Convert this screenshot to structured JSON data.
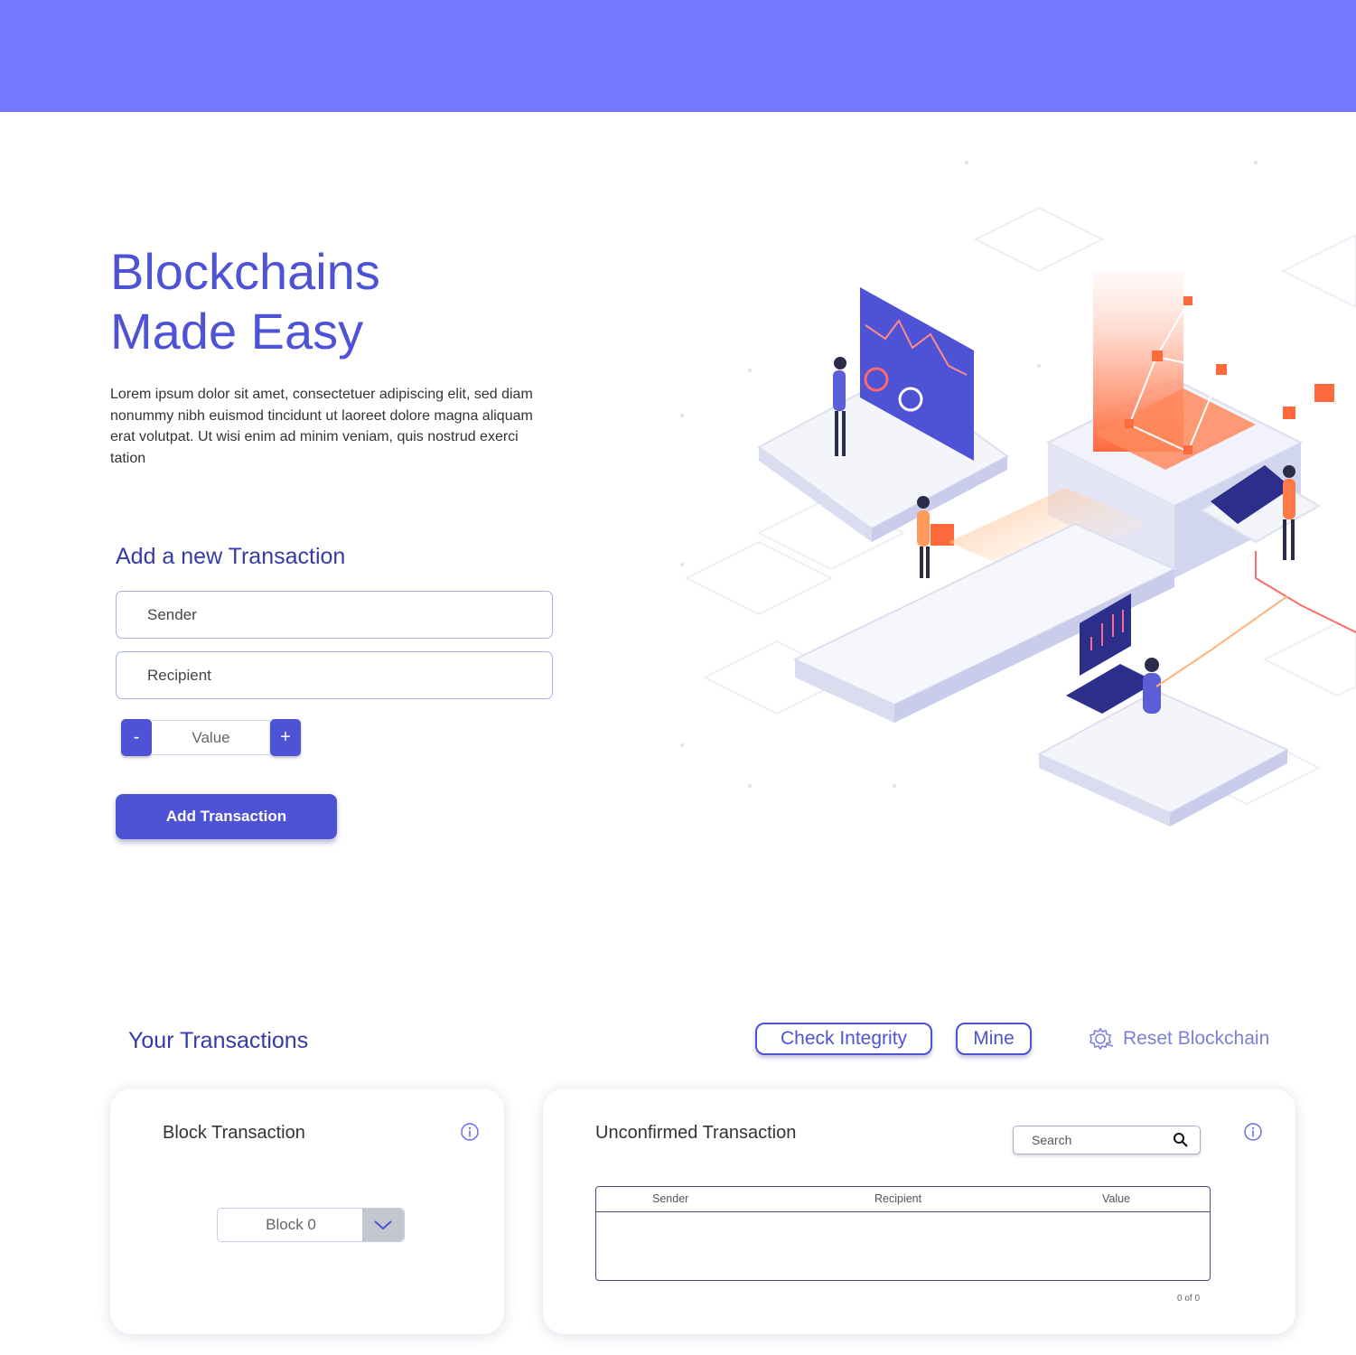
{
  "hero": {
    "title_line1": "Blockchains",
    "title_line2": "Made Easy",
    "description": "Lorem ipsum dolor sit amet, consectetuer adipiscing elit, sed diam nonummy nibh euismod tincidunt ut laoreet dolore magna aliquam erat volutpat. Ut wisi enim ad minim veniam, quis nostrud exerci tation"
  },
  "form": {
    "title": "Add a new Transaction",
    "sender_placeholder": "Sender",
    "recipient_placeholder": "Recipient",
    "value_placeholder": "Value",
    "minus_label": "-",
    "plus_label": "+",
    "submit_label": "Add Transaction"
  },
  "transactions": {
    "title": "Your Transactions",
    "check_integrity_label": "Check Integrity",
    "mine_label": "Mine",
    "reset_label": "Reset Blockchain"
  },
  "block_card": {
    "title": "Block Transaction",
    "selected_block": "Block 0"
  },
  "unconfirmed_card": {
    "title": "Unconfirmed Transaction",
    "search_placeholder": "Search",
    "columns": [
      "Sender",
      "Recipient",
      "Value"
    ],
    "rows": [],
    "pager": "0 of 0"
  },
  "colors": {
    "topbar": "#7578fe",
    "primary": "#4e52d4",
    "heading": "#353aa8"
  },
  "icons": {
    "reset": "gear-icon",
    "info": "info-icon",
    "search": "search-icon",
    "dropdown": "chevron-down-icon"
  }
}
